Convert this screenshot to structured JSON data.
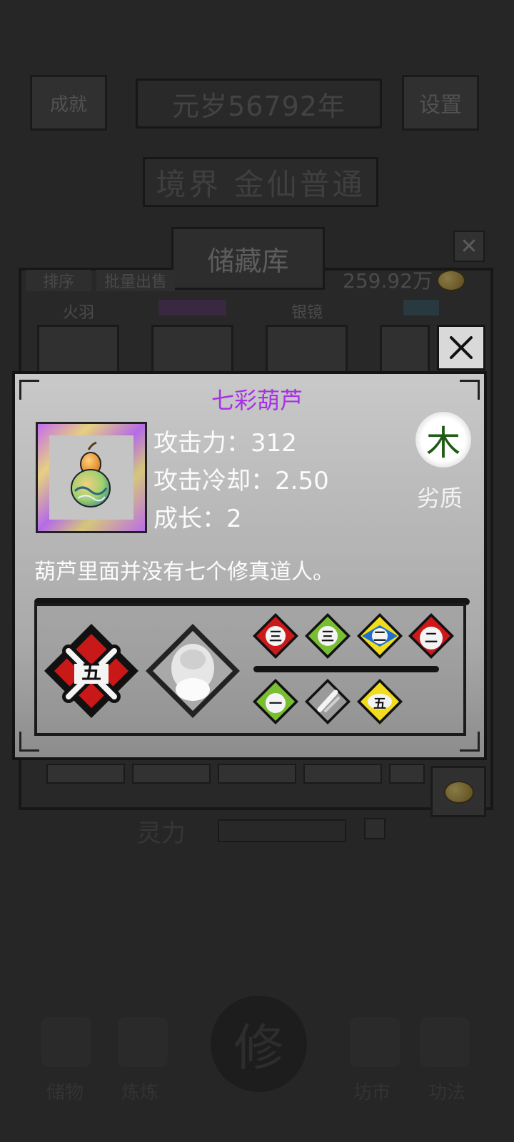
{
  "background": {
    "top_left_label": "成就",
    "year_text": "元岁56792年",
    "settings_label": "设置",
    "realm_text": "境界 金仙普通",
    "storage_title": "储藏库",
    "sort_label": "排序",
    "bulk_sell_label": "批量出售",
    "money_text": "259.92万",
    "categories": [
      "火羽",
      "",
      "银镜",
      ""
    ],
    "spirit_label": "灵力",
    "nav": [
      "储物",
      "炼炼",
      "",
      "坊市",
      "功法"
    ]
  },
  "popup": {
    "item_name": "七彩葫芦",
    "stats": [
      {
        "label": "攻击力：",
        "value": "312"
      },
      {
        "label": "攻击冷却：",
        "value": "2.50"
      },
      {
        "label": "成长：",
        "value": "2"
      }
    ],
    "element": "木",
    "quality": "劣质",
    "description": "葫芦里面并没有七个修真道人。",
    "skills": {
      "main": {
        "label": "五",
        "color": "#c81818"
      },
      "small_top": [
        {
          "label": "三",
          "color": "#cc1a1a"
        },
        {
          "label": "三",
          "color": "#78bd32"
        },
        {
          "label": "二",
          "color": "#f1dc1e"
        },
        {
          "label": "二",
          "color": "#cc1a1a"
        }
      ],
      "small_bottom": [
        {
          "label": "一",
          "color": "#78bd32"
        },
        {
          "label": "",
          "color": "#9a9a9a"
        },
        {
          "label": "五",
          "color": "#f1dc1e"
        }
      ]
    }
  },
  "colors": {
    "item_name": "#a830e8",
    "element_text": "#1d5a12"
  }
}
